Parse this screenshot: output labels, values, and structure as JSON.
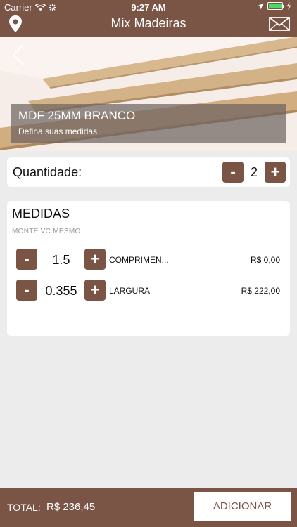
{
  "status": {
    "carrier": "Carrier",
    "time": "9:27 AM",
    "battery_level": 1.0
  },
  "nav": {
    "title": "Mix Madeiras",
    "left_icon": "location-pin-icon",
    "right_icon": "mail-icon"
  },
  "product": {
    "name": "MDF 25MM BRANCO",
    "subtitle": "Defina suas medidas"
  },
  "quantity": {
    "label": "Quantidade:",
    "minus": "-",
    "value": "2",
    "plus": "+"
  },
  "measures": {
    "title": "MEDIDAS",
    "subtitle": "MONTE VC MESMO",
    "rows": [
      {
        "minus": "-",
        "value": "1.5",
        "plus": "+",
        "label": "COMPRIMEN...",
        "price": "R$ 0,00"
      },
      {
        "minus": "-",
        "value": "0.355",
        "plus": "+",
        "label": "LARGURA",
        "price": "R$ 222,00"
      }
    ]
  },
  "footer": {
    "total_label": "TOTAL:",
    "total_value": "R$ 236,45",
    "add_label": "ADICIONAR"
  },
  "colors": {
    "brand": "#7a5546",
    "background": "#ececec",
    "battery": "#4cd964"
  }
}
